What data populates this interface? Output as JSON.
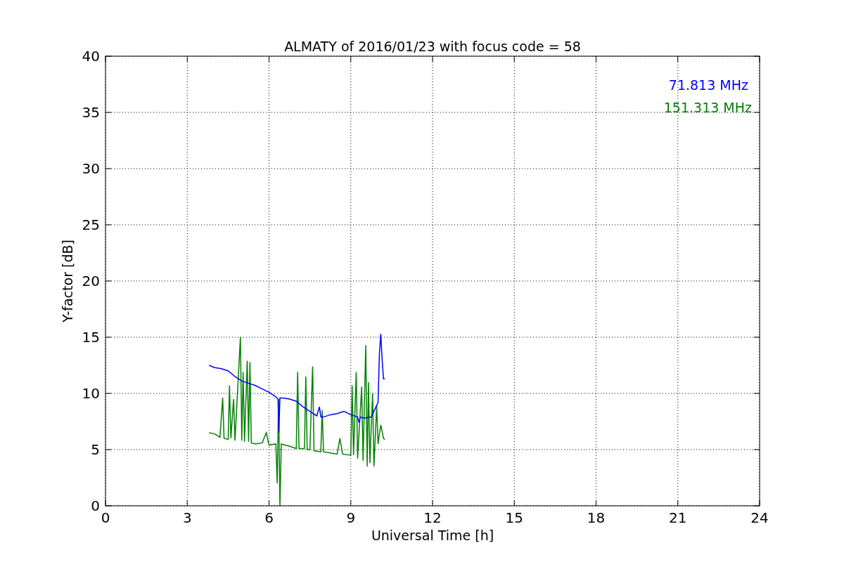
{
  "figure": {
    "chart_data": {
      "type": "line",
      "grid": true,
      "title": "ALMATY of 2016/01/23 with focus code = 58",
      "xlabel": "Universal Time [h]",
      "ylabel": "Y-factor [dB]",
      "xlim": [
        0,
        24
      ],
      "ylim": [
        0,
        40
      ],
      "xticks": [
        0,
        3,
        6,
        9,
        12,
        15,
        18,
        21,
        24
      ],
      "yticks": [
        0,
        5,
        10,
        15,
        20,
        25,
        30,
        35,
        40
      ],
      "series": [
        {
          "name": "71.813 MHz",
          "color": "#0000ff",
          "x": [
            3.8,
            4.0,
            4.25,
            4.5,
            4.75,
            5.0,
            5.25,
            5.5,
            5.75,
            6.0,
            6.25,
            6.33,
            6.36,
            6.4,
            6.5,
            6.75,
            7.0,
            7.25,
            7.5,
            7.75,
            7.85,
            7.9,
            8.0,
            8.25,
            8.5,
            8.75,
            9.0,
            9.25,
            9.3,
            9.35,
            9.5,
            9.75,
            10.0,
            10.05,
            10.1,
            10.15,
            10.2,
            10.25
          ],
          "values": [
            12.5,
            12.3,
            12.2,
            12.0,
            11.5,
            11.1,
            10.9,
            10.7,
            10.4,
            10.1,
            9.7,
            9.5,
            6.5,
            9.6,
            9.6,
            9.5,
            9.3,
            8.8,
            8.4,
            8.0,
            8.8,
            7.9,
            7.9,
            8.1,
            8.2,
            8.4,
            8.1,
            7.9,
            7.4,
            7.9,
            7.8,
            7.9,
            9.2,
            13.5,
            15.3,
            13.0,
            11.3,
            11.3
          ]
        },
        {
          "name": "151.313 MHz",
          "color": "#008000",
          "x": [
            3.8,
            4.0,
            4.2,
            4.3,
            4.35,
            4.5,
            4.55,
            4.6,
            4.7,
            4.75,
            4.95,
            5.0,
            5.05,
            5.1,
            5.2,
            5.25,
            5.3,
            5.35,
            5.5,
            5.75,
            5.9,
            6.0,
            6.25,
            6.3,
            6.35,
            6.4,
            6.45,
            6.75,
            7.0,
            7.05,
            7.1,
            7.3,
            7.35,
            7.4,
            7.5,
            7.6,
            7.65,
            7.9,
            7.95,
            8.0,
            8.25,
            8.5,
            8.6,
            8.7,
            9.0,
            9.05,
            9.1,
            9.2,
            9.25,
            9.4,
            9.45,
            9.55,
            9.6,
            9.65,
            9.7,
            9.8,
            9.85,
            9.95,
            10.0,
            10.1,
            10.2,
            10.25
          ],
          "values": [
            6.5,
            6.4,
            6.1,
            9.6,
            6.0,
            5.9,
            10.7,
            6.0,
            9.5,
            5.8,
            15.0,
            5.8,
            11.9,
            5.7,
            12.9,
            5.7,
            12.8,
            5.6,
            5.5,
            5.6,
            6.5,
            5.4,
            5.5,
            2.0,
            9.5,
            0,
            5.5,
            5.3,
            5.1,
            11.9,
            5.1,
            5.1,
            11.5,
            5.0,
            5.0,
            12.4,
            4.9,
            4.8,
            8.5,
            4.8,
            4.7,
            4.6,
            6.0,
            4.6,
            4.5,
            10.7,
            4.5,
            11.9,
            4.2,
            10.6,
            4.0,
            14.3,
            3.5,
            11.0,
            3.8,
            10.0,
            3.5,
            8.9,
            5.5,
            7.2,
            6.0,
            5.9
          ]
        }
      ]
    }
  }
}
